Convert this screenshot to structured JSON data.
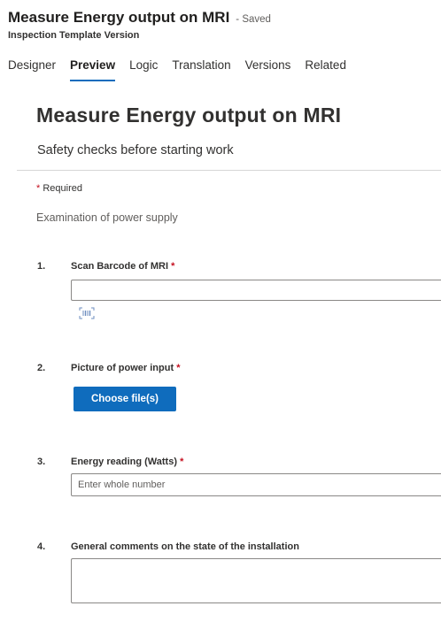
{
  "header": {
    "title": "Measure Energy output on MRI",
    "saved_status": "- Saved",
    "entity_type": "Inspection Template Version"
  },
  "tabs": [
    {
      "label": "Designer",
      "active": false
    },
    {
      "label": "Preview",
      "active": true
    },
    {
      "label": "Logic",
      "active": false
    },
    {
      "label": "Translation",
      "active": false
    },
    {
      "label": "Versions",
      "active": false
    },
    {
      "label": "Related",
      "active": false
    }
  ],
  "form": {
    "title": "Measure Energy output on MRI",
    "subtitle": "Safety checks before starting work",
    "required_marker": "*",
    "required_text": "Required",
    "section_title": "Examination of power supply",
    "questions": [
      {
        "number": "1.",
        "label": "Scan Barcode of MRI",
        "required": "*",
        "value": "",
        "icon": "barcode-scan-icon"
      },
      {
        "number": "2.",
        "label": "Picture of power input",
        "required": "*",
        "button_label": "Choose file(s)"
      },
      {
        "number": "3.",
        "label": "Energy reading (Watts)",
        "required": "*",
        "placeholder": "Enter whole number",
        "value": ""
      },
      {
        "number": "4.",
        "label": "General comments on the state of the installation",
        "value": ""
      }
    ]
  },
  "colors": {
    "accent": "#0f6cbd",
    "required": "#c50f1f",
    "text": "#323130",
    "border": "#8a8886"
  }
}
